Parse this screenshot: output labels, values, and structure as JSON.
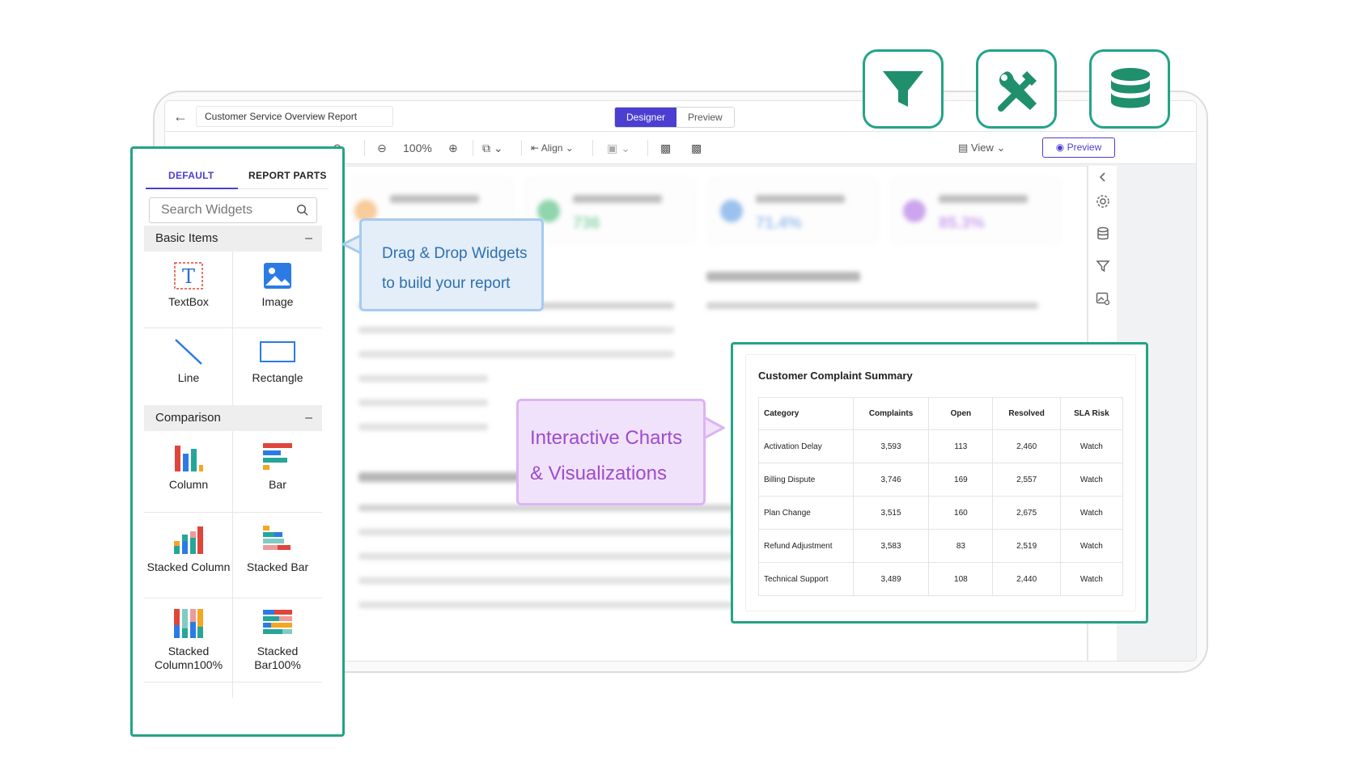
{
  "header": {
    "report_title": "Customer Service Overview Report",
    "mode_designer": "Designer",
    "mode_preview": "Preview"
  },
  "toolbar": {
    "zoom": "100%",
    "align_label": "Align",
    "view_label": "View",
    "preview_label": "Preview"
  },
  "widget_panel": {
    "tabs": [
      "DEFAULT",
      "REPORT PARTS"
    ],
    "search_placeholder": "Search Widgets",
    "sections": {
      "basic": {
        "title": "Basic Items",
        "items": [
          "TextBox",
          "Image",
          "Line",
          "Rectangle"
        ]
      },
      "comparison": {
        "title": "Comparison",
        "items": [
          "Column",
          "Bar",
          "Stacked Column",
          "Stacked Bar",
          "Stacked Column100%",
          "Stacked Bar100%"
        ]
      }
    }
  },
  "canvas": {
    "kpis": [
      {
        "value": "",
        "color": "#f2a24a"
      },
      {
        "value": "736",
        "color": "#34b36a"
      },
      {
        "value": "71.4%",
        "color": "#4b8fe0"
      },
      {
        "value": "85.3%",
        "color": "#a25be0"
      }
    ]
  },
  "callouts": {
    "drag_line1": "Drag & Drop Widgets",
    "drag_line2": "to build your report",
    "charts_line1": "Interactive Charts",
    "charts_line2": "& Visualizations"
  },
  "complaint_summary": {
    "title": "Customer Complaint Summary",
    "columns": [
      "Category",
      "Complaints",
      "Open",
      "Resolved",
      "SLA Risk"
    ],
    "rows": [
      [
        "Activation Delay",
        "3,593",
        "113",
        "2,460",
        "Watch"
      ],
      [
        "Billing Dispute",
        "3,746",
        "169",
        "2,557",
        "Watch"
      ],
      [
        "Plan Change",
        "3,515",
        "160",
        "2,675",
        "Watch"
      ],
      [
        "Refund Adjustment",
        "3,583",
        "83",
        "2,519",
        "Watch"
      ],
      [
        "Technical Support",
        "3,489",
        "108",
        "2,440",
        "Watch"
      ]
    ]
  },
  "colors": {
    "accent": "#4b3fd1",
    "highlight": "#24a386"
  },
  "icons": {
    "badges": [
      "filter-icon",
      "tools-icon",
      "database-icon"
    ],
    "rail": [
      "collapse-icon",
      "settings-icon",
      "database-icon",
      "filter-icon",
      "image-settings-icon"
    ]
  }
}
